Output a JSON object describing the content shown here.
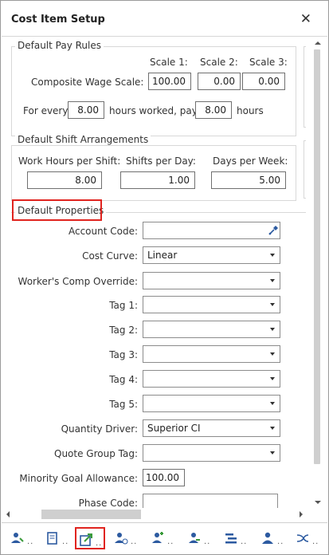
{
  "window": {
    "title": "Cost Item Setup",
    "close_glyph": "✕"
  },
  "pay_rules": {
    "title": "Default Pay Rules",
    "scale_headers": [
      "Scale 1:",
      "Scale 2:",
      "Scale 3:"
    ],
    "composite_label": "Composite Wage Scale:",
    "scale_values": [
      "100.00",
      "0.00",
      "0.00"
    ],
    "for_every_label": "For every",
    "hours_worked": "8.00",
    "hours_worked_pay_label": "hours worked, pay",
    "hours_paid": "8.00",
    "hours_label": "hours"
  },
  "shift": {
    "title": "Default Shift Arrangements",
    "work_hours_label": "Work Hours per Shift:",
    "shifts_per_day_label": "Shifts per Day:",
    "days_per_week_label": "Days per Week:",
    "work_hours": "8.00",
    "shifts_per_day": "1.00",
    "days_per_week": "5.00"
  },
  "properties": {
    "title": "Default Properties",
    "account_code_label": "Account Code:",
    "account_code": "",
    "cost_curve_label": "Cost Curve:",
    "cost_curve": "Linear",
    "workers_comp_label": "Worker's Comp Override:",
    "workers_comp": "",
    "tag1_label": "Tag 1:",
    "tag2_label": "Tag 2:",
    "tag3_label": "Tag 3:",
    "tag4_label": "Tag 4:",
    "tag5_label": "Tag 5:",
    "quantity_driver_label": "Quantity Driver:",
    "quantity_driver": "Superior CI",
    "quote_group_label": "Quote Group Tag:",
    "minority_goal_label": "Minority Goal Allowance:",
    "minority_goal": "100.00",
    "phase_code_label": "Phase Code:"
  },
  "toolbar": {
    "items": [
      "resources-icon",
      "document-icon",
      "export-icon",
      "user-schedule-icon",
      "add-user-icon",
      "crew-icon",
      "list-icon",
      "person-icon",
      "shuffle-icon"
    ],
    "dots": ".."
  },
  "colors": {
    "highlight": "#e0241f",
    "icon_blue": "#2c5aa0",
    "icon_green": "#3a9a3a"
  }
}
